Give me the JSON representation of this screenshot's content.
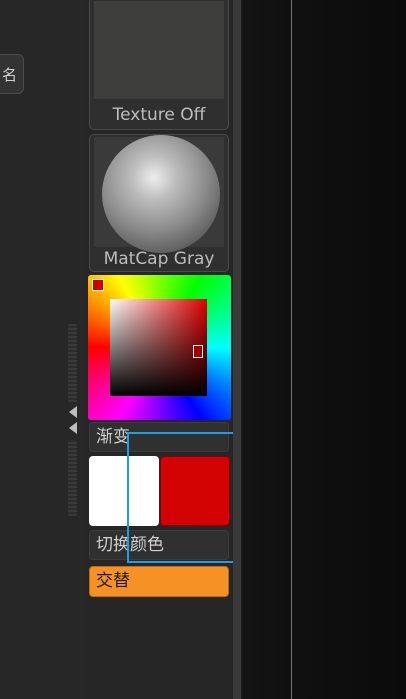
{
  "left_panel": {
    "button_label": "名"
  },
  "materials": {
    "texture": {
      "label": "Texture Off"
    },
    "matcap": {
      "label": "MatCap Gray"
    }
  },
  "color_picker": {
    "gradient_label": "渐变"
  },
  "swatches": {
    "main_color": "#ffffff",
    "alternate_color": "#d40303"
  },
  "buttons": {
    "swap_label": "切换颜色",
    "alternate_label": "交替"
  },
  "colors": {
    "accent": "#f59125",
    "selection": "#1f9ee8"
  }
}
